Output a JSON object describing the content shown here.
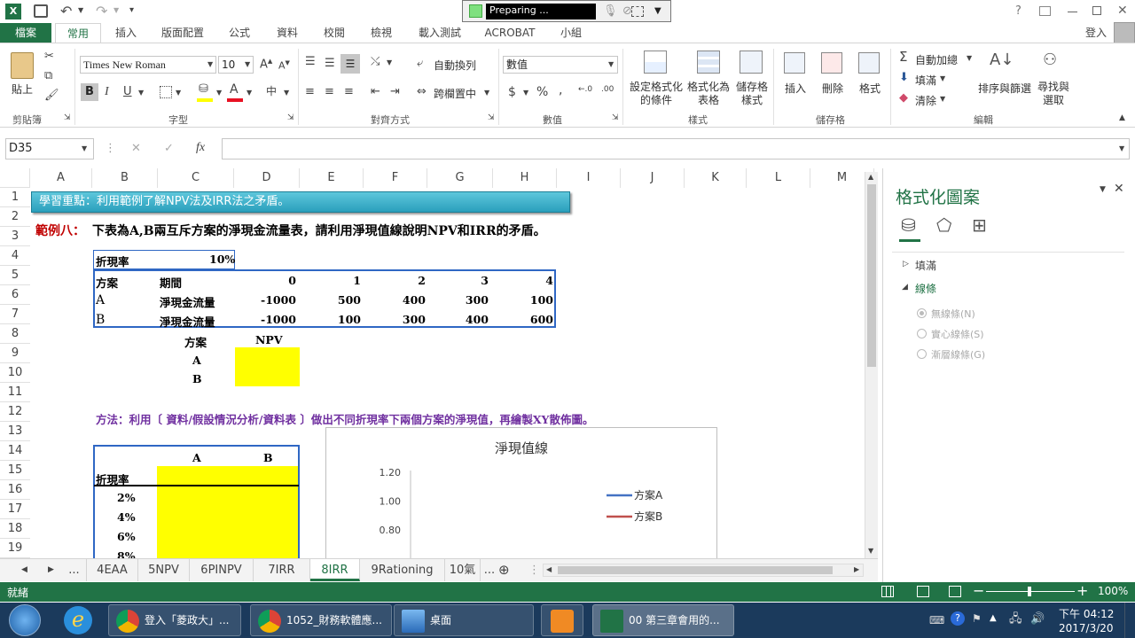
{
  "titlebar": {
    "preparing": "Preparing ...",
    "signin": "登入",
    "help": "?"
  },
  "tabs": [
    "檔案",
    "常用",
    "插入",
    "版面配置",
    "公式",
    "資料",
    "校閱",
    "檢視",
    "載入測試",
    "ACROBAT",
    "小組"
  ],
  "ribbon": {
    "paste": "貼上",
    "clipboard": "剪貼簿",
    "font_name": "Times New Roman",
    "font_size": "10",
    "font_group": "字型",
    "wrap_text": "自動換列",
    "merge_center": "跨欄置中",
    "alignment_group": "對齊方式",
    "number_format": "數值",
    "number_group": "數值",
    "cond_format": [
      "設定格式化",
      "的條件"
    ],
    "format_table": [
      "格式化為",
      "表格"
    ],
    "cell_styles": [
      "儲存格",
      "樣式"
    ],
    "styles_group": "樣式",
    "insert": "插入",
    "delete": "刪除",
    "format": "格式",
    "cells_group": "儲存格",
    "autosum": "自動加總",
    "fill": "填滿",
    "clear": "清除",
    "sort_filter": "排序與篩選",
    "find_select": [
      "尋找與",
      "選取"
    ],
    "editing_group": "編輯"
  },
  "formula_bar": {
    "name_box": "D35",
    "fx": "fx",
    "value": ""
  },
  "columns": [
    "A",
    "B",
    "C",
    "D",
    "E",
    "F",
    "G",
    "H",
    "I",
    "J",
    "K",
    "L",
    "M"
  ],
  "rows": [
    "1",
    "2",
    "3",
    "4",
    "5",
    "6",
    "7",
    "8",
    "9",
    "10",
    "11",
    "12",
    "13",
    "14",
    "15",
    "16",
    "17",
    "18",
    "19"
  ],
  "sheet": {
    "banner": "學習重點：利用範例了解NPV法及IRR法之矛盾。",
    "example_label": "範例八：",
    "example_text": "下表為A,B兩互斥方案的淨現金流量表，請利用淨現值線說明NPV和IRR的矛盾。",
    "rate_label": "折現率",
    "rate_value": "10%",
    "hdr_plan": "方案",
    "hdr_period": "期間",
    "periods": [
      "0",
      "1",
      "2",
      "3",
      "4"
    ],
    "row_a_label": "A",
    "row_b_label": "B",
    "cashflow_label": "淨現金流量",
    "row_a_values": [
      "-1000",
      "500",
      "400",
      "300",
      "100"
    ],
    "row_b_values": [
      "-1000",
      "100",
      "300",
      "400",
      "600"
    ],
    "npv_hdr_plan": "方案",
    "npv_hdr": "NPV",
    "npv_a": "A",
    "npv_b": "B",
    "method": "方法：利用〔 資料/假設情況分析/資料表 〕做出不同折現率下兩個方案的淨現值，再繪製XY散佈圖。",
    "t2_a": "A",
    "t2_b": "B",
    "t2_rate": "折現率",
    "t2_rates": [
      "2%",
      "4%",
      "6%",
      "8%"
    ]
  },
  "chart_data": {
    "type": "line",
    "title": "淨現值線",
    "y_ticks": [
      "1.20",
      "1.00",
      "0.80"
    ],
    "ylim": [
      0.8,
      1.2
    ],
    "series": [
      {
        "name": "方案A",
        "color": "#4472c4",
        "values": []
      },
      {
        "name": "方案B",
        "color": "#c0504d",
        "values": []
      }
    ],
    "legend": "right"
  },
  "sheet_tabs": [
    "...",
    "4EAA",
    "5NPV",
    "6PINPV",
    "7IRR",
    "8IRR",
    "9Rationing",
    "10氣",
    "..."
  ],
  "active_sheet": "8IRR",
  "status": {
    "ready": "就緒",
    "zoom": "100%"
  },
  "pane": {
    "title": "格式化圖案",
    "fill": "填滿",
    "line": "線條",
    "opt_none": "無線條(N)",
    "opt_solid": "實心線條(S)",
    "opt_gradient": "漸層線條(G)"
  },
  "taskbar": {
    "items": [
      "登入「菱政大」...",
      "1052_財務軟體應...",
      "桌面",
      "",
      "00 第三章會用的..."
    ],
    "time": "下午 04:12",
    "date": "2017/3/20"
  }
}
